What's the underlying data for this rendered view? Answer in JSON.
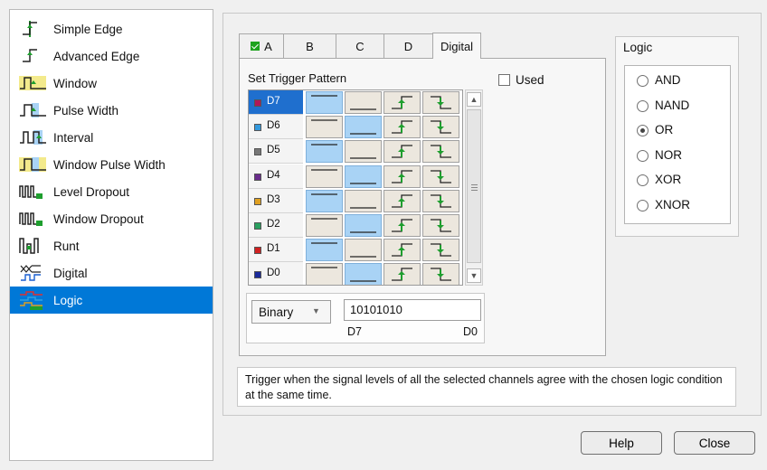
{
  "trigger_types": [
    {
      "label": "Simple Edge",
      "icon": "simple-edge-icon",
      "selected": false
    },
    {
      "label": "Advanced Edge",
      "icon": "advanced-edge-icon",
      "selected": false
    },
    {
      "label": "Window",
      "icon": "window-icon",
      "selected": false
    },
    {
      "label": "Pulse Width",
      "icon": "pulse-width-icon",
      "selected": false
    },
    {
      "label": "Interval",
      "icon": "interval-icon",
      "selected": false
    },
    {
      "label": "Window Pulse Width",
      "icon": "window-pulse-width-icon",
      "selected": false
    },
    {
      "label": "Level Dropout",
      "icon": "level-dropout-icon",
      "selected": false
    },
    {
      "label": "Window Dropout",
      "icon": "window-dropout-icon",
      "selected": false
    },
    {
      "label": "Runt",
      "icon": "runt-icon",
      "selected": false
    },
    {
      "label": "Digital",
      "icon": "digital-icon",
      "selected": false
    },
    {
      "label": "Logic",
      "icon": "logic-icon",
      "selected": true
    }
  ],
  "tabs": [
    {
      "label": "A",
      "checked": true,
      "active": false
    },
    {
      "label": "B",
      "checked": false,
      "active": false
    },
    {
      "label": "C",
      "checked": false,
      "active": false
    },
    {
      "label": "D",
      "checked": false,
      "active": false
    },
    {
      "label": "Digital",
      "checked": false,
      "active": true
    }
  ],
  "pattern": {
    "title": "Set Trigger Pattern",
    "used_label": "Used",
    "used_checked": false,
    "channels": [
      {
        "name": "D7",
        "color": "#b0185a",
        "state": "high"
      },
      {
        "name": "D6",
        "color": "#3399dd",
        "state": "low"
      },
      {
        "name": "D5",
        "color": "#777777",
        "state": "high"
      },
      {
        "name": "D4",
        "color": "#6a2c8c",
        "state": "low"
      },
      {
        "name": "D3",
        "color": "#e0a020",
        "state": "high"
      },
      {
        "name": "D2",
        "color": "#2aa060",
        "state": "low"
      },
      {
        "name": "D1",
        "color": "#d02020",
        "state": "high"
      },
      {
        "name": "D0",
        "color": "#1a2a9a",
        "state": "low"
      }
    ],
    "selected_channel": "D7",
    "format_value": "Binary",
    "value": "10101010",
    "msb_label": "D7",
    "lsb_label": "D0"
  },
  "logic": {
    "title": "Logic",
    "options": [
      "AND",
      "NAND",
      "OR",
      "NOR",
      "XOR",
      "XNOR"
    ],
    "selected": "OR"
  },
  "description": "Trigger when the signal levels of all the selected channels agree with the chosen logic condition at the same time.",
  "buttons": {
    "help": "Help",
    "close": "Close"
  },
  "colors": {
    "selection": "#0078d7",
    "cell_on": "#a9d3f5",
    "cell_off": "#ece7de",
    "edge_green": "#1e9e2e"
  }
}
